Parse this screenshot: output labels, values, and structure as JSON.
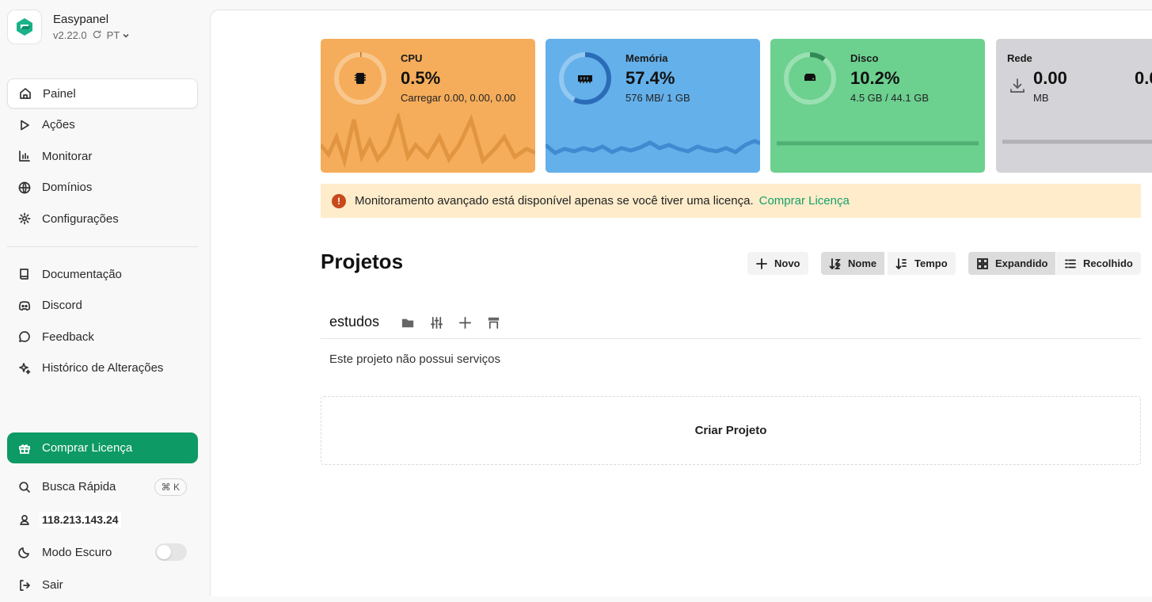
{
  "app": {
    "name": "Easypanel",
    "version": "v2.22.0",
    "language": "PT"
  },
  "nav": [
    {
      "label": "Painel",
      "icon": "home-icon",
      "active": true
    },
    {
      "label": "Ações",
      "icon": "play-icon"
    },
    {
      "label": "Monitorar",
      "icon": "bar-chart-icon"
    },
    {
      "label": "Domínios",
      "icon": "globe-icon"
    },
    {
      "label": "Configurações",
      "icon": "gear-icon"
    }
  ],
  "nav_secondary": [
    {
      "label": "Documentação",
      "icon": "book-icon"
    },
    {
      "label": "Discord",
      "icon": "discord-icon"
    },
    {
      "label": "Feedback",
      "icon": "chat-icon"
    },
    {
      "label": "Histórico de Alterações",
      "icon": "sparkles-icon"
    }
  ],
  "bottom": {
    "buy_label": "Comprar Licença",
    "search_label": "Busca Rápida",
    "search_shortcut": "⌘ K",
    "ip": "118.213.143.24",
    "dark_mode_label": "Modo Escuro",
    "dark_mode_on": false,
    "logout_label": "Sair"
  },
  "cards": {
    "cpu": {
      "label": "CPU",
      "value": "0.5%",
      "sub": "Carregar 0.00, 0.00, 0.00",
      "percent": 0.5,
      "color": "#f5ad5b"
    },
    "memory": {
      "label": "Memória",
      "value": "57.4%",
      "sub": "576 MB/ 1 GB",
      "percent": 57.4,
      "color": "#64b0ea"
    },
    "disk": {
      "label": "Disco",
      "value": "10.2%",
      "sub": "4.5 GB / 44.1 GB",
      "percent": 10.2,
      "color": "#6cd08f"
    },
    "network": {
      "label": "Rede",
      "value": "0.00",
      "value2": "0.0",
      "sub": "MB",
      "color": "#d4d4d8"
    }
  },
  "alert": {
    "text": "Monitoramento avançado está disponível apenas se você tiver uma licença.",
    "link": "Comprar Licença"
  },
  "projects": {
    "title": "Projetos",
    "new_label": "Novo",
    "sort_name_label": "Nome",
    "sort_time_label": "Tempo",
    "expanded_label": "Expandido",
    "collapsed_label": "Recolhido",
    "items": [
      {
        "name": "estudos",
        "empty_text": "Este projeto não possui serviços"
      }
    ],
    "create_label": "Criar Projeto"
  }
}
